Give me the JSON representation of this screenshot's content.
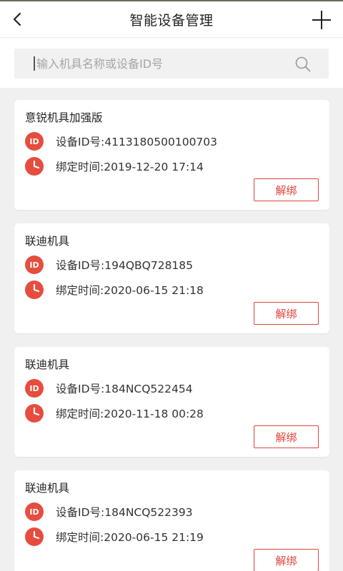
{
  "header": {
    "title": "智能设备管理",
    "back_icon": "back-arrow-icon",
    "add_icon": "plus-icon"
  },
  "search": {
    "placeholder": "输入机具名称或设备ID号",
    "value": "",
    "icon": "search-icon"
  },
  "devices": [
    {
      "name": "意锐机具加强版",
      "id_label": "设备ID号:4113180500100703",
      "bind_time_label": "绑定时间:2019-12-20 17:14",
      "unbind_label": "解绑",
      "badge_text": "ID"
    },
    {
      "name": "联迪机具",
      "id_label": "设备ID号:194QBQ728185",
      "bind_time_label": "绑定时间:2020-06-15 21:18",
      "unbind_label": "解绑",
      "badge_text": "ID"
    },
    {
      "name": "联迪机具",
      "id_label": "设备ID号:184NCQ522454",
      "bind_time_label": "绑定时间:2020-11-18 00:28",
      "unbind_label": "解绑",
      "badge_text": "ID"
    },
    {
      "name": "联迪机具",
      "id_label": "设备ID号:184NCQ522393",
      "bind_time_label": "绑定时间:2020-06-15 21:19",
      "unbind_label": "解绑",
      "badge_text": "ID"
    }
  ],
  "colors": {
    "accent": "#e0443a",
    "badge": "#e64d3f",
    "background": "#f0f0f0"
  }
}
